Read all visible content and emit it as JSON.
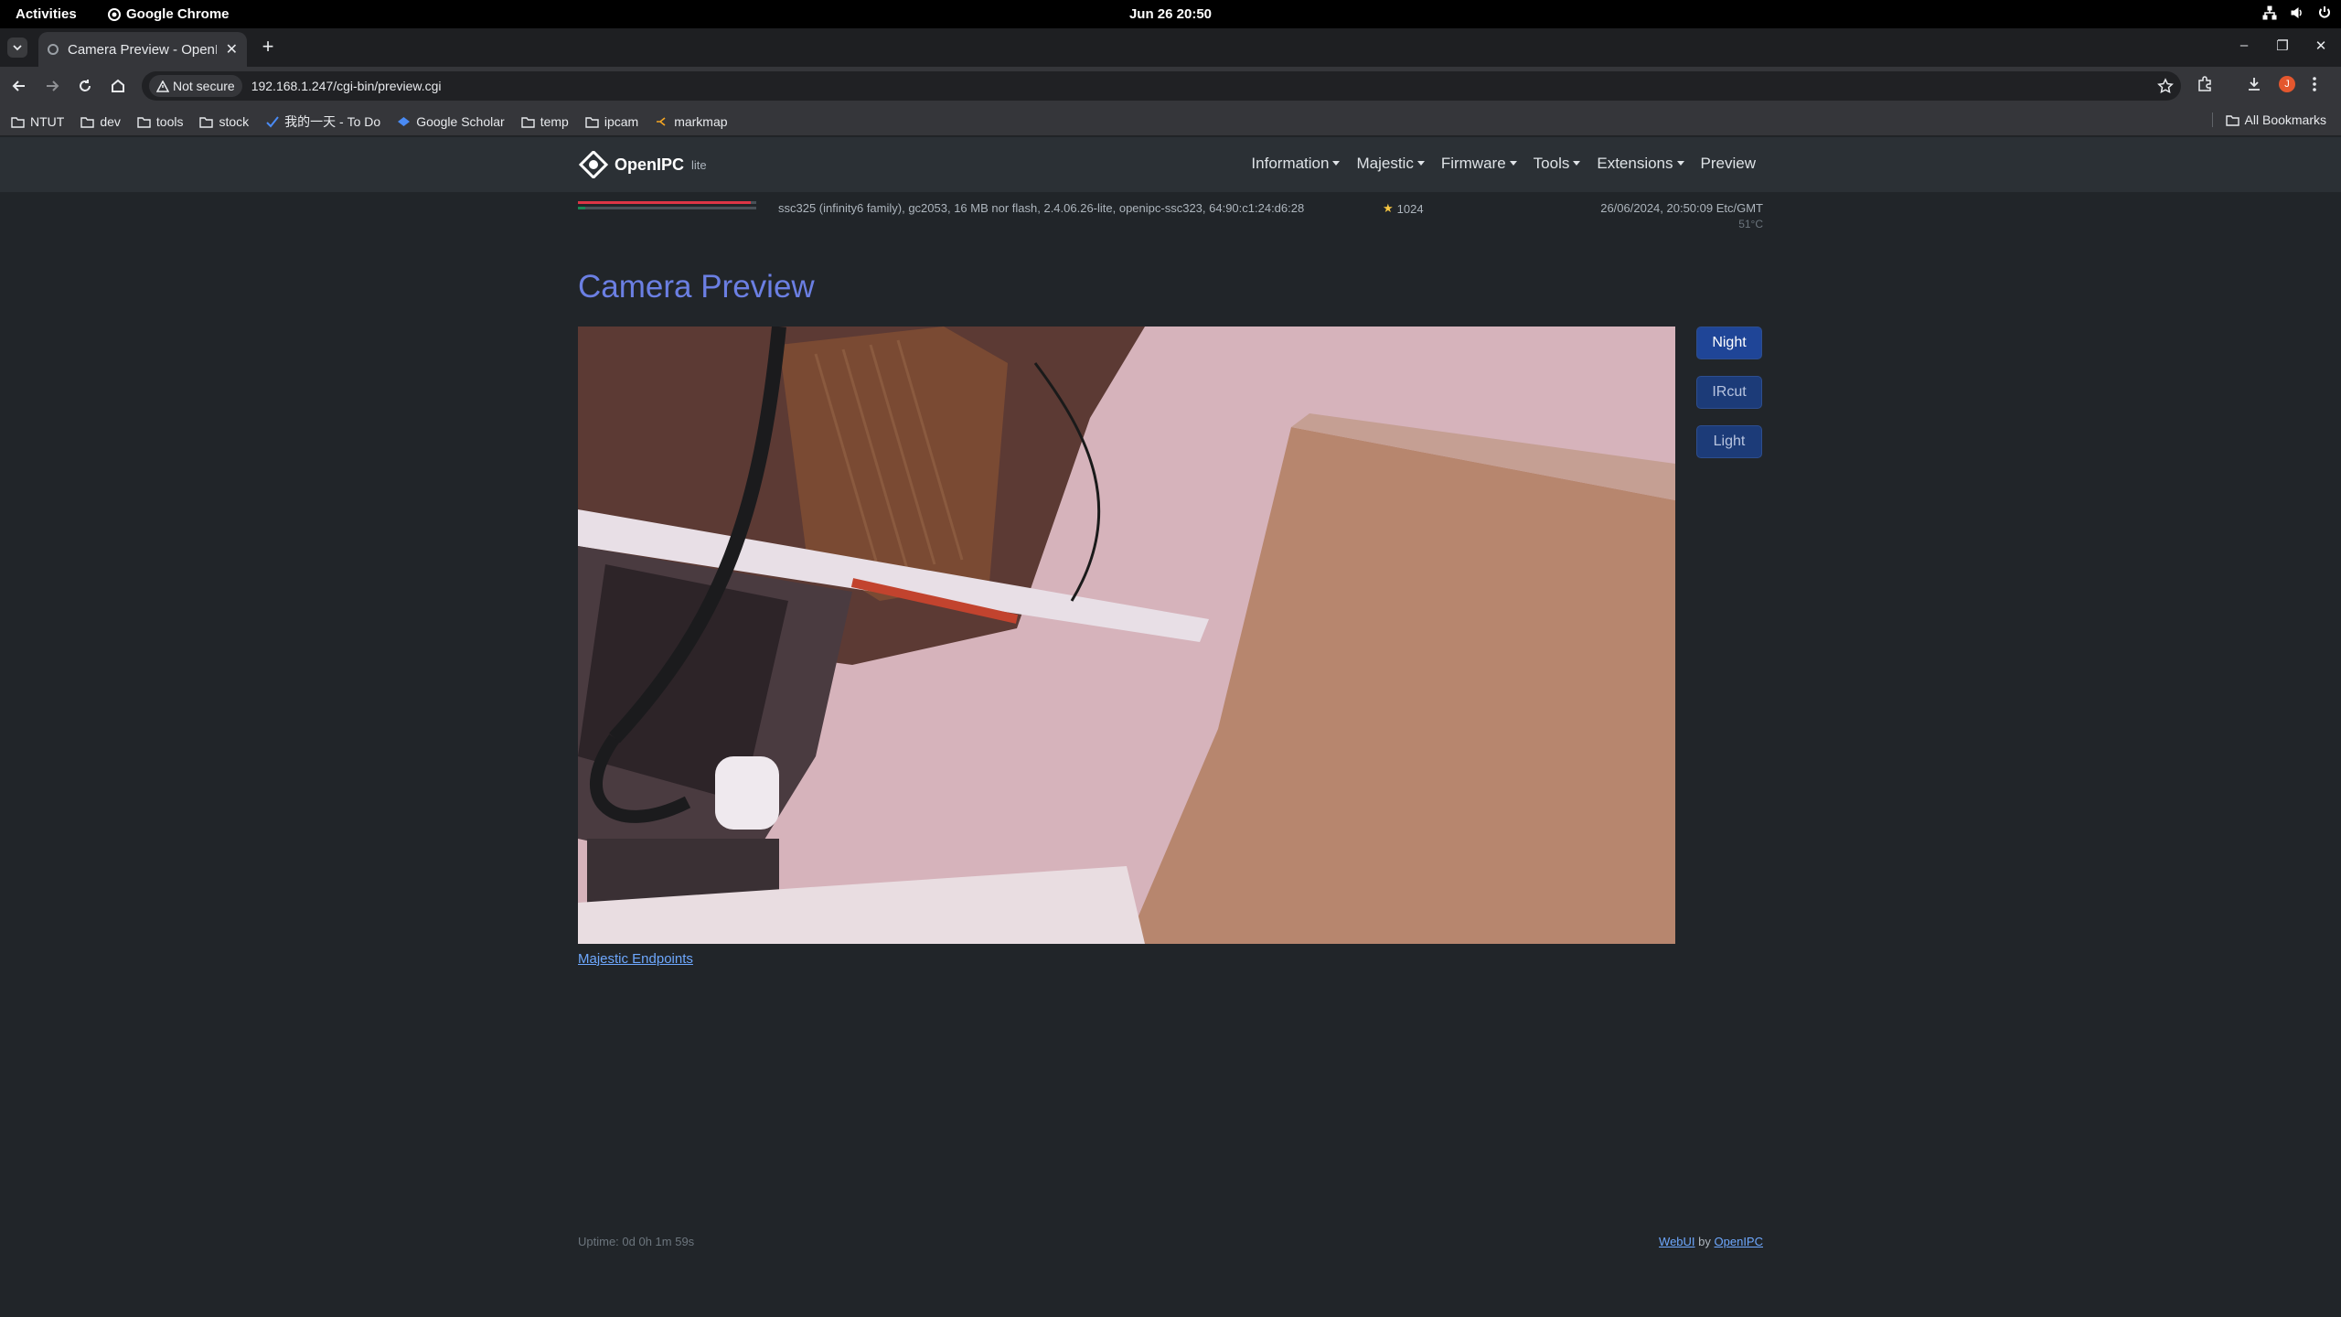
{
  "system": {
    "activities": "Activities",
    "app_name": "Google Chrome",
    "clock": "Jun 26  20:50"
  },
  "browser": {
    "tab_title": "Camera Preview - OpenIPC",
    "not_secure": "Not secure",
    "url": "192.168.1.247/cgi-bin/preview.cgi",
    "profile_initial": "J",
    "bookmarks": [
      {
        "label": "NTUT",
        "icon": "folder-icon"
      },
      {
        "label": "dev",
        "icon": "folder-icon"
      },
      {
        "label": "tools",
        "icon": "folder-icon"
      },
      {
        "label": "stock",
        "icon": "folder-icon"
      },
      {
        "label": "我的一天 - To Do",
        "icon": "todo-icon"
      },
      {
        "label": "Google Scholar",
        "icon": "scholar-icon"
      },
      {
        "label": "temp",
        "icon": "folder-icon"
      },
      {
        "label": "ipcam",
        "icon": "folder-icon"
      },
      {
        "label": "markmap",
        "icon": "markmap-icon"
      }
    ],
    "all_bookmarks": "All Bookmarks"
  },
  "navbar": {
    "brand": "OpenIPC",
    "brand_suffix": "lite",
    "items": [
      {
        "label": "Information",
        "dropdown": true
      },
      {
        "label": "Majestic",
        "dropdown": true
      },
      {
        "label": "Firmware",
        "dropdown": true
      },
      {
        "label": "Tools",
        "dropdown": true
      },
      {
        "label": "Extensions",
        "dropdown": true
      },
      {
        "label": "Preview",
        "dropdown": false
      }
    ]
  },
  "status": {
    "memory_fraction": 0.97,
    "overlay_fraction": 0.04,
    "system_info": "ssc325 (infinity6 family), gc2053, 16 MB nor flash, 2.4.06.26-lite, openipc-ssc323, 64:90:c1:24:d6:28",
    "score": "1024",
    "datetime": "26/06/2024, 20:50:09 Etc/GMT",
    "temperature": "51°C"
  },
  "main": {
    "title": "Camera Preview",
    "buttons": {
      "night": "Night",
      "ircut": "IRcut",
      "light": "Light"
    },
    "endpoints_link": "Majestic Endpoints"
  },
  "footer": {
    "uptime": "Uptime: 0d 0h 1m 59s",
    "webui": "WebUI",
    "by": "by",
    "openipc": "OpenIPC"
  },
  "colors": {
    "accent": "#6b7fe3",
    "primary_button": "#1f4597",
    "link": "#6ea8fe"
  }
}
